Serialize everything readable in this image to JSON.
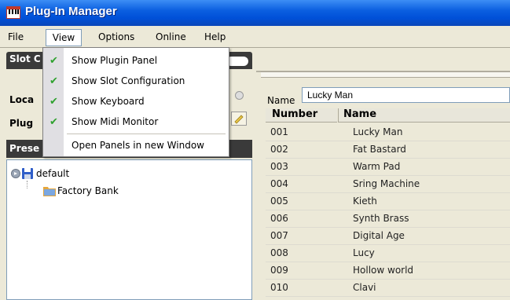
{
  "window": {
    "title": "Plug-In Manager"
  },
  "menubar": {
    "file": "File",
    "view": "View",
    "options": "Options",
    "online": "Online",
    "help": "Help"
  },
  "view_menu": {
    "items": [
      {
        "label": "Show Plugin Panel",
        "checked": true
      },
      {
        "label": "Show Slot Configuration",
        "checked": true
      },
      {
        "label": "Show Keyboard",
        "checked": true
      },
      {
        "label": "Show Midi Monitor",
        "checked": true
      },
      {
        "label": "Open Panels in new Window",
        "checked": false
      }
    ],
    "check_glyph": "✔"
  },
  "slot_panel": {
    "title": "Slot C",
    "label_local": "Loca",
    "label_plug": "Plug"
  },
  "preset_panel": {
    "title": "Prese"
  },
  "tree": {
    "root": "default",
    "child": "Factory Bank"
  },
  "name_field": {
    "label": "Name",
    "value": "Lucky Man"
  },
  "preset_table": {
    "headers": [
      "Number",
      "Name"
    ],
    "rows": [
      {
        "number": "001",
        "name": "Lucky Man"
      },
      {
        "number": "002",
        "name": "Fat Bastard"
      },
      {
        "number": "003",
        "name": "Warm Pad"
      },
      {
        "number": "004",
        "name": "Sring Machine"
      },
      {
        "number": "005",
        "name": "Kieth"
      },
      {
        "number": "006",
        "name": "Synth Brass"
      },
      {
        "number": "007",
        "name": "Digital Age"
      },
      {
        "number": "008",
        "name": "Lucy"
      },
      {
        "number": "009",
        "name": "Hollow world"
      },
      {
        "number": "010",
        "name": "Clavi"
      }
    ]
  },
  "colors": {
    "titlebar": "#0050d8",
    "check": "#2fa12f",
    "panel_header": "#3a3a3a"
  }
}
